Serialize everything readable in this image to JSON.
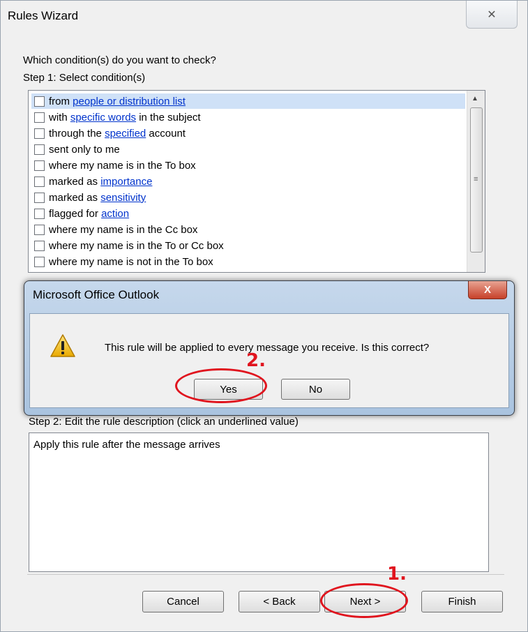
{
  "window": {
    "title": "Rules Wizard",
    "close_glyph": "✕"
  },
  "step1": {
    "question": "Which condition(s) do you want to check?",
    "label": "Step 1: Select condition(s)"
  },
  "conditions": [
    {
      "before": "from ",
      "link": "people or distribution list",
      "after": "",
      "checked": false,
      "selected": true
    },
    {
      "before": "with ",
      "link": "specific words",
      "after": " in the subject",
      "checked": false,
      "selected": false
    },
    {
      "before": "through the ",
      "link": "specified",
      "after": " account",
      "checked": false,
      "selected": false
    },
    {
      "before": "sent only to me",
      "link": "",
      "after": "",
      "checked": false,
      "selected": false
    },
    {
      "before": "where my name is in the To box",
      "link": "",
      "after": "",
      "checked": false,
      "selected": false
    },
    {
      "before": "marked as ",
      "link": "importance",
      "after": "",
      "checked": false,
      "selected": false
    },
    {
      "before": "marked as ",
      "link": "sensitivity",
      "after": "",
      "checked": false,
      "selected": false
    },
    {
      "before": "flagged for ",
      "link": "action",
      "after": "",
      "checked": false,
      "selected": false
    },
    {
      "before": "where my name is in the Cc box",
      "link": "",
      "after": "",
      "checked": false,
      "selected": false
    },
    {
      "before": "where my name is in the To or Cc box",
      "link": "",
      "after": "",
      "checked": false,
      "selected": false
    },
    {
      "before": "where my name is not in the To box",
      "link": "",
      "after": "",
      "checked": false,
      "selected": false
    }
  ],
  "step2": {
    "label": "Step 2: Edit the rule description (click an underlined value)",
    "description": "Apply this rule after the message arrives"
  },
  "buttons": {
    "cancel": "Cancel",
    "back": "< Back",
    "next": "Next >",
    "finish": "Finish"
  },
  "dialog": {
    "title": "Microsoft Office Outlook",
    "close_glyph": "X",
    "message": "This rule will be applied to every message you receive. Is this correct?",
    "yes": "Yes",
    "no": "No",
    "icon": "warning-icon"
  },
  "annotations": {
    "step1": "1.",
    "step2": "2.",
    "color": "#e0141e"
  }
}
